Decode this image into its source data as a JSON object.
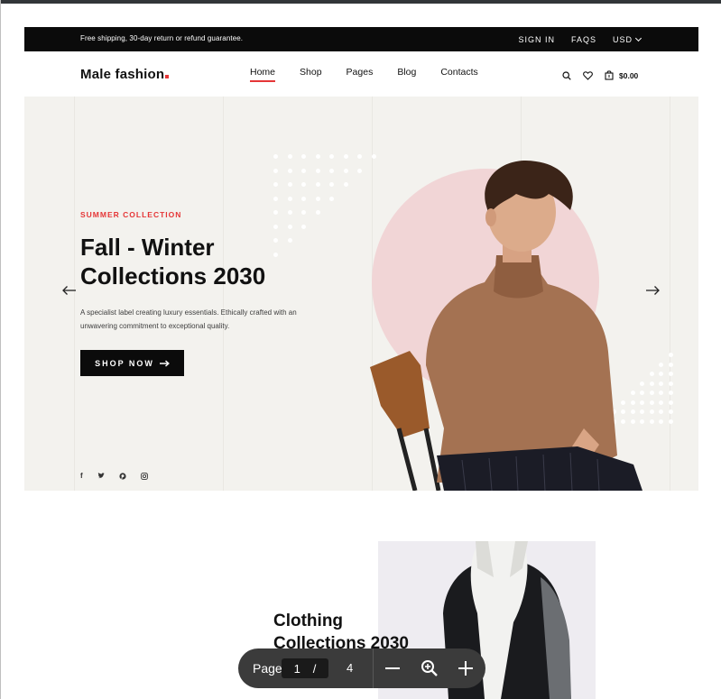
{
  "topbar": {
    "note": "Free shipping, 30-day return or refund guarantee.",
    "sign_in": "SIGN IN",
    "faqs": "FAQS",
    "currency": "USD"
  },
  "header": {
    "logo": "Male fashion",
    "nav": [
      "Home",
      "Shop",
      "Pages",
      "Blog",
      "Contacts"
    ],
    "active_nav": "Home",
    "cart_total": "$0.00"
  },
  "hero": {
    "kicker": "SUMMER COLLECTION",
    "title": "Fall - Winter Collections 2030",
    "description": "A specialist label creating luxury essentials. Ethically crafted with an unwavering commitment to exceptional quality.",
    "button": "SHOP NOW",
    "socials": [
      "f",
      "•",
      "•",
      "•"
    ]
  },
  "section2": {
    "title": "Clothing Collections 2030"
  },
  "pdf_toolbar": {
    "page_label": "Page",
    "current_page": "1",
    "separator": "/",
    "total_pages": "4"
  },
  "colors": {
    "accent": "#e53637",
    "hero_bg": "#f3f2ee",
    "circle": "#f1d5d6",
    "dark": "#0b0b0b"
  }
}
